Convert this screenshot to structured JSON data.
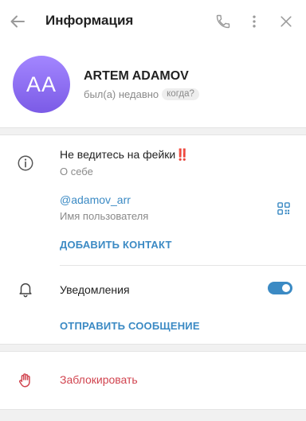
{
  "header": {
    "title": "Информация",
    "back_icon": "arrow-left-icon",
    "call_icon": "phone-icon",
    "menu_icon": "more-vertical-icon",
    "close_icon": "close-icon"
  },
  "profile": {
    "initials": "AA",
    "name": "ARTEM ADAMOV",
    "status": "был(а) недавно",
    "when_badge": "когда?",
    "avatar_color_top": "#a386ff",
    "avatar_color_bottom": "#7b5be6"
  },
  "info": {
    "bio": "Не ведитесь на фейки",
    "bio_emoji": "‼️",
    "bio_label": "О себе",
    "username": "@adamov_arr",
    "username_label": "Имя пользователя",
    "add_contact": "ДОБАВИТЬ КОНТАКТ"
  },
  "notifications": {
    "label": "Уведомления",
    "enabled": true,
    "send_message": "ОТПРАВИТЬ СООБЩЕНИЕ"
  },
  "block": {
    "label": "Заблокировать"
  },
  "colors": {
    "accent": "#3b8ac4",
    "danger": "#d1444f",
    "muted": "#8a8a8a"
  }
}
